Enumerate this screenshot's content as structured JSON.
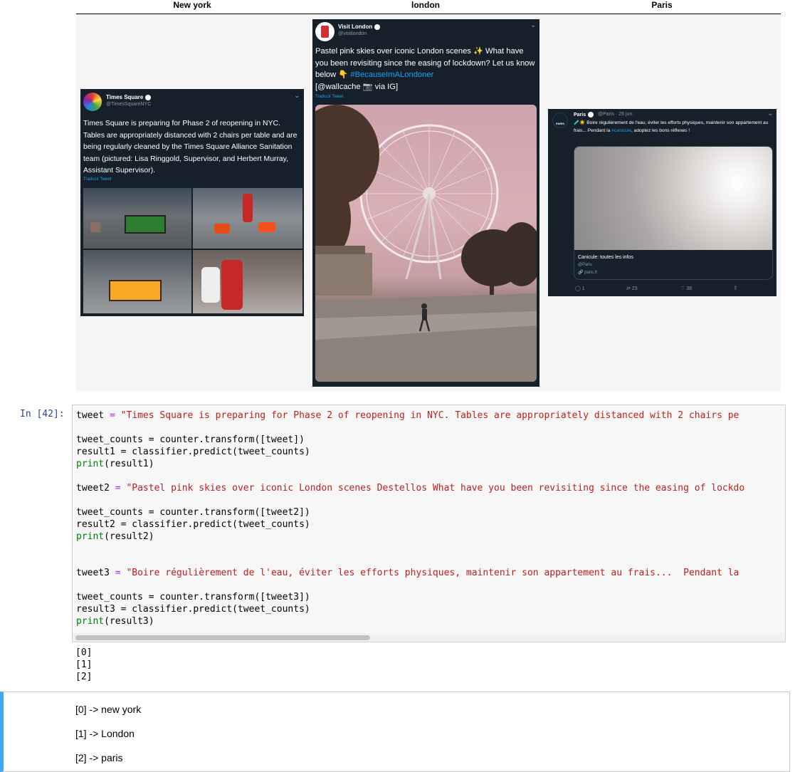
{
  "table": {
    "headers": [
      "New york",
      "london",
      "Paris"
    ]
  },
  "tweets": {
    "nyc": {
      "name": "Times Square",
      "handle": "@TimesSquareNYC",
      "text": "Times Square is preparing for Phase 2 of reopening in NYC. Tables are appropriately distanced with 2 chairs per table and are being regularly cleaned by the Times Square Alliance Sanitation team (pictured: Lisa Ringgold, Supervisor, and Herbert Murray, Assistant Supervisor).",
      "translate": "Traducir Tweet"
    },
    "london": {
      "name": "Visit London",
      "handle": "@visitlondon",
      "text_1": "Pastel pink skies over iconic London scenes ✨ What have you been revisiting since the easing of lockdown? Let us know below 👇 ",
      "hashtag": "#BecauseImALondoner",
      "text_2": "[@wallcache 📷 via IG]",
      "translate": "Traducir Tweet"
    },
    "paris": {
      "name": "Paris",
      "handle": "@Paris · 26 jun.",
      "avatar_label": "PARIS",
      "text_1": "🧪☀️ Boire régulièrement de l'eau, éviter les efforts physiques, maintenir son appartement au frais... Pendant la ",
      "hashtag": "#canicule",
      "text_2": ", adoptez les bons réflexes !",
      "card_title": "Canicule: toutes les infos",
      "card_handle": "@Paris",
      "card_link": "🔗 paris.fr",
      "replies": "1",
      "retweets": "23",
      "likes": "38"
    }
  },
  "code_cell": {
    "prompt": "In [42]:",
    "lines": [
      {
        "a": "tweet ",
        "op": "=",
        "s": " \"Times Square is preparing for Phase 2 of reopening in NYC. Tables are appropriately distanced with 2 chairs pe"
      },
      {
        "plain": "tweet_counts = counter.transform([tweet])"
      },
      {
        "plain": "result1 = classifier.predict(tweet_counts)"
      },
      {
        "bi": "print",
        "rest": "(result1)"
      },
      {
        "a": "tweet2 ",
        "op": "=",
        "s": " \"Pastel pink skies over iconic London scenes Destellos What have you been revisiting since the easing of lockdo"
      },
      {
        "plain": "tweet_counts = counter.transform([tweet2])"
      },
      {
        "plain": "result2 = classifier.predict(tweet_counts)"
      },
      {
        "bi": "print",
        "rest": "(result2)"
      },
      {
        "a": "tweet3 ",
        "op": "=",
        "s": " \"Boire régulièrement de l'eau, éviter les efforts physiques, maintenir son appartement au frais...  Pendant la"
      },
      {
        "plain": "tweet_counts = counter.transform([tweet3])"
      },
      {
        "plain": "result3 = classifier.predict(tweet_counts)"
      },
      {
        "bi": "print",
        "rest": "(result3)"
      }
    ]
  },
  "outputs": [
    "[0]",
    "[1]",
    "[2]"
  ],
  "markdown": {
    "lines": [
      "[0] -> new york",
      "[1] -> London",
      "[2] -> paris"
    ]
  }
}
